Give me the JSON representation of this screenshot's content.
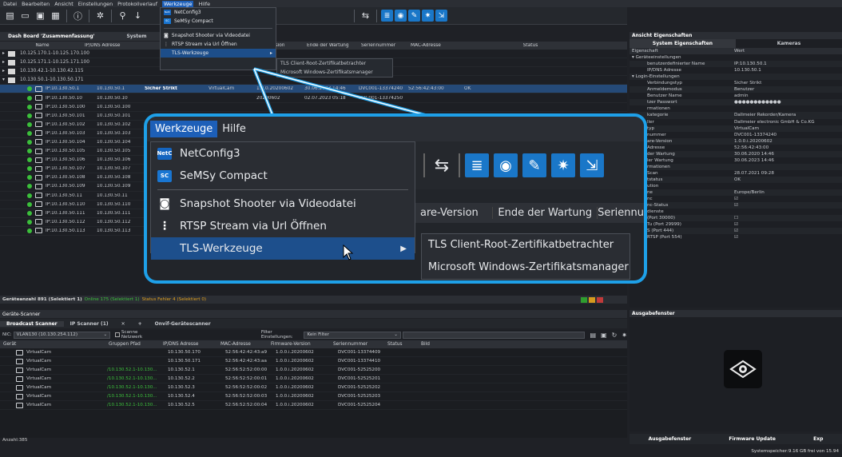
{
  "menubar": {
    "items": [
      "Datei",
      "Bearbeiten",
      "Ansicht",
      "Einstellungen",
      "Protokollverlauf",
      "Werkzeuge",
      "Hilfe"
    ]
  },
  "toolbar": {
    "icons": [
      "open-icon",
      "folder-icon",
      "save-icon",
      "save-as-icon",
      "info-icon",
      "settings-icon",
      "search-icon",
      "sort-icon",
      "tls-icon",
      "log-icon",
      "eye-icon",
      "edit-icon",
      "gear-icon",
      "export-icon"
    ]
  },
  "dashboard": {
    "tab_label": "Dash Board 'Zusammenfassung'",
    "system_label": "System"
  },
  "tree": {
    "columns": [
      "Name",
      "IP/DNS Adresse",
      "",
      "",
      "",
      "are-Version",
      "Ende der Wartung",
      "Seriennummer",
      "MAC-Adresse",
      "Status"
    ],
    "groups": [
      "10.125.170.1-10.125.170.100",
      "10.125.171.1-10.125.171.100",
      "10.130.42.1-10.130.42.115",
      "10.130.50.1-10.130.50.171"
    ],
    "rows": [
      {
        "name": "IP:10.130.50.1",
        "ip": "10.130.50.1",
        "sec": "Sicher Strikt",
        "type": "VirtualCam",
        "fw": "1.0.0.20200602",
        "end": "30.06.2023 14:46",
        "serial": "DVC001-13374240",
        "mac": "52:56:42:43:00",
        "status": "OK",
        "selected": true
      },
      {
        "name": "IP:10.130.50.10",
        "ip": "10.130.50.10",
        "sec": "",
        "type": "",
        "fw": "20200602",
        "end": "02.07.2023 05:18",
        "serial": "DVC001-13374250",
        "mac": "",
        "status": "",
        "selected": false
      },
      {
        "name": "IP:10.130.50.100",
        "ip": "10.130.50.100",
        "selected": false
      },
      {
        "name": "IP:10.130.50.101",
        "ip": "10.130.50.101",
        "selected": false
      },
      {
        "name": "IP:10.130.50.102",
        "ip": "10.130.50.102",
        "selected": false
      },
      {
        "name": "IP:10.130.50.103",
        "ip": "10.130.50.103",
        "selected": false
      },
      {
        "name": "IP:10.130.50.104",
        "ip": "10.130.50.104",
        "selected": false
      },
      {
        "name": "IP:10.130.50.105",
        "ip": "10.130.50.105",
        "selected": false
      },
      {
        "name": "IP:10.130.50.106",
        "ip": "10.130.50.106",
        "selected": false
      },
      {
        "name": "IP:10.130.50.107",
        "ip": "10.130.50.107",
        "selected": false
      },
      {
        "name": "IP:10.130.50.108",
        "ip": "10.130.50.108",
        "selected": false
      },
      {
        "name": "IP:10.130.50.109",
        "ip": "10.130.50.109",
        "selected": false
      },
      {
        "name": "IP:10.130.50.11",
        "ip": "10.130.50.11",
        "selected": false
      },
      {
        "name": "IP:10.130.50.110",
        "ip": "10.130.50.110",
        "selected": false
      },
      {
        "name": "IP:10.130.50.111",
        "ip": "10.130.50.111",
        "selected": false
      },
      {
        "name": "IP:10.130.50.112",
        "ip": "10.130.50.112",
        "selected": false
      },
      {
        "name": "IP:10.130.50.113",
        "ip": "10.130.50.113",
        "selected": false
      }
    ]
  },
  "status_bar": {
    "count": "Geräteanzahl 891 (Selektiert 1)",
    "online": "Online 175 (Selektiert 1)",
    "state": "Status Fehler 4 (Selektiert 0)"
  },
  "werkzeuge_menu": {
    "items": [
      {
        "label": "NetConfig3",
        "icon": "NetC",
        "color": "#1565c0"
      },
      {
        "label": "SeMSy Compact",
        "icon": "SC",
        "color": "#1976d2"
      },
      {
        "label": "Snapshot Shooter via Videodatei",
        "icon": "camera-icon",
        "color": ""
      },
      {
        "label": "RTSP Stream via Url Öffnen",
        "icon": "rtsp-icon",
        "color": ""
      },
      {
        "label": "TLS-Werkzeuge",
        "icon": "",
        "color": ""
      }
    ],
    "submenu": [
      "TLS Client-Root-Zertifikatbetrachter",
      "Microsoft Windows-Zertifikatsmanager"
    ]
  },
  "zoom": {
    "menu_werkzeuge": "Werkzeuge",
    "menu_hilfe": "Hilfe",
    "header_cols": [
      "are-Version",
      "Ende der Wartung",
      "Seriennu"
    ]
  },
  "properties": {
    "title": "Ansicht Eigenschaften",
    "tab1": "System Eigenschaften",
    "tab2": "Kameras",
    "col_k": "Eigenschaft",
    "col_v": "Wert",
    "rows": [
      {
        "k": "▾ Geräteeinstellungen",
        "v": ""
      },
      {
        "k": "benutzerdefinierter Name",
        "v": "IP:10.130.50.1"
      },
      {
        "k": "IP/DNS Adresse",
        "v": "10.130.50.1"
      },
      {
        "k": "▾ Login-Einstellungen",
        "v": ""
      },
      {
        "k": "Verbindungstyp",
        "v": "Sicher Strikt"
      },
      {
        "k": "Anmeldemodus",
        "v": "Benutzer"
      },
      {
        "k": "Benutzer Name",
        "v": "admin"
      },
      {
        "k": "tzer Passwort",
        "v": "●●●●●●●●●●●●"
      },
      {
        "k": "rmationen",
        "v": ""
      },
      {
        "k": "kategorie",
        "v": "Dallmeier Rekorder/Kamera"
      },
      {
        "k": "ller",
        "v": "Dallmeier electronic GmbH & Co.KG"
      },
      {
        "k": "typ",
        "v": "VirtualCam"
      },
      {
        "k": "nummer",
        "v": "DVC001-13374240"
      },
      {
        "k": "are-Version",
        "v": "1.0.0.i.20200602"
      },
      {
        "k": "Adresse",
        "v": "52:56:42:43:00"
      },
      {
        "k": "der Wartung",
        "v": "30.06.2020 14:46"
      },
      {
        "k": "ler Wartung",
        "v": "30.06.2023 14:46"
      },
      {
        "k": "rmationen",
        "v": ""
      },
      {
        "k": "Scan",
        "v": "28.07.2021 09:28"
      },
      {
        "k": "tstatus",
        "v": "OK"
      },
      {
        "k": "ution",
        "v": ""
      },
      {
        "k": "ne",
        "v": "Europe/Berlin"
      },
      {
        "k": "nc",
        "v": "☑"
      },
      {
        "k": "nc-Status",
        "v": "☑"
      },
      {
        "k": "dienste",
        "v": ""
      },
      {
        "k": "(Port 30000)",
        "v": "☐"
      },
      {
        "k": "Tu (Port 29999)",
        "v": "☑"
      },
      {
        "k": "S (Port 444)",
        "v": "☑"
      },
      {
        "k": "RTSP (Port 554)",
        "v": "☑"
      }
    ]
  },
  "scanner": {
    "title": "Geräte-Scanner",
    "tabs": [
      "Broadcast Scanner",
      "IP Scanner (1)",
      "+",
      "Onvif-Gerätescanner"
    ],
    "nic_label": "NIC:",
    "nic_value": "VLAN130 (10.130.254.112)",
    "scan_label": "Scanne Netzwerk",
    "filter_label": "Filter Einstellungen:",
    "filter_value": "Kein Filter",
    "columns": [
      "Gerät",
      "Gruppen Pfad",
      "IP/DNS Adresse",
      "MAC-Adresse",
      "Firmware-Version",
      "Seriennummer",
      "Status",
      "Bild"
    ],
    "rows": [
      {
        "dev": "VirtualCam",
        "path": "",
        "ip": "10.130.50.170",
        "mac": "52:56:42:42:43:a9",
        "fw": "1.0.0.i.20200602",
        "sn": "DVC001-13374409"
      },
      {
        "dev": "VirtualCam",
        "path": "",
        "ip": "10.130.50.171",
        "mac": "52:56:42:42:43:aa",
        "fw": "1.0.0.i.20200602",
        "sn": "DVC001-13374410"
      },
      {
        "dev": "VirtualCam",
        "path": "/10.130.52.1-10.130...",
        "ip": "10.130.52.1",
        "mac": "52:56:52:52:00:00",
        "fw": "1.0.0.i.20200602",
        "sn": "DVC001-52525200"
      },
      {
        "dev": "VirtualCam",
        "path": "/10.130.52.1-10.130...",
        "ip": "10.130.52.2",
        "mac": "52:56:52:52:00:01",
        "fw": "1.0.0.i.20200602",
        "sn": "DVC001-52525201"
      },
      {
        "dev": "VirtualCam",
        "path": "/10.130.52.1-10.130...",
        "ip": "10.130.52.3",
        "mac": "52:56:52:52:00:02",
        "fw": "1.0.0.i.20200602",
        "sn": "DVC001-52525202"
      },
      {
        "dev": "VirtualCam",
        "path": "/10.130.52.1-10.130...",
        "ip": "10.130.52.4",
        "mac": "52:56:52:52:00:03",
        "fw": "1.0.0.i.20200602",
        "sn": "DVC001-52525203"
      },
      {
        "dev": "VirtualCam",
        "path": "/10.130.52.1-10.130...",
        "ip": "10.130.52.5",
        "mac": "52:56:52:52:00:04",
        "fw": "1.0.0.i.20200602",
        "sn": "DVC001-52525204"
      }
    ],
    "count": "Anzahl:385"
  },
  "ausgabe": {
    "title": "Ausgabefenster",
    "tabs": [
      "Ausgabefenster",
      "Firmware Update",
      "Exp"
    ]
  },
  "footer": {
    "memory": "Systemspeicher:9.16 GB frei von 15.94"
  }
}
